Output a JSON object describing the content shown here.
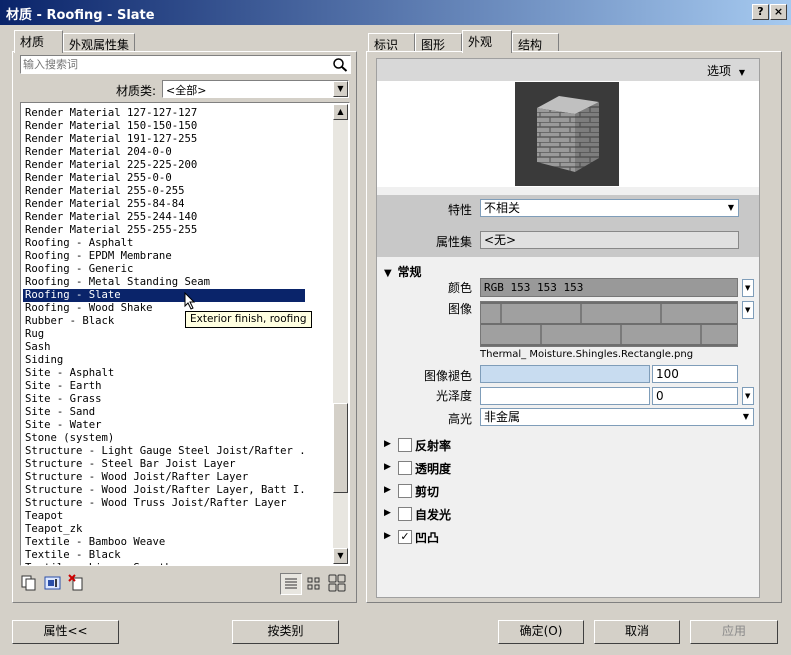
{
  "window": {
    "title": "材质 - Roofing - Slate",
    "help": "?",
    "close": "×"
  },
  "left": {
    "tabs": [
      "材质",
      "外观属性集"
    ],
    "search_placeholder": "输入搜索词",
    "category_label": "材质类:",
    "category_value": "<全部>",
    "materials": [
      "Render Material 127-127-127",
      "Render Material 150-150-150",
      "Render Material 191-127-255",
      "Render Material 204-0-0",
      "Render Material 225-225-200",
      "Render Material 255-0-0",
      "Render Material 255-0-255",
      "Render Material 255-84-84",
      "Render Material 255-244-140",
      "Render Material 255-255-255",
      "Roofing - Asphalt",
      "Roofing - EPDM Membrane",
      "Roofing - Generic",
      "Roofing - Metal Standing Seam",
      "Roofing - Slate",
      "Roofing - Wood Shake",
      "Rubber - Black",
      "Rug",
      "Sash",
      "Siding",
      "Site - Asphalt",
      "Site - Earth",
      "Site - Grass",
      "Site - Sand",
      "Site - Water",
      "Stone (system)",
      "Structure - Light Gauge Steel Joist/Rafter ...",
      "Structure - Steel Bar Joist Layer",
      "Structure - Wood Joist/Rafter Layer",
      "Structure - Wood Joist/Rafter Layer, Batt I...",
      "Structure - Wood Truss Joist/Rafter Layer",
      "Teapot",
      "Teapot_zk",
      "Textile - Bamboo Weave",
      "Textile - Black",
      "Textile - Linen, Smooth"
    ],
    "selected_index": 14,
    "tooltip": "Exterior finish, roofing"
  },
  "right": {
    "tabs": [
      "标识",
      "图形",
      "外观",
      "结构"
    ],
    "active_tab": 2,
    "options_label": "选项",
    "property_label": "特性",
    "property_value": "不相关",
    "propset_label": "属性集",
    "propset_value": "<无>",
    "general_section": "常规",
    "color_label": "颜色",
    "color_value": "RGB 153 153 153",
    "image_label": "图像",
    "image_filename": "Thermal_ Moisture.Shingles.Rectangle.png",
    "image_fade_label": "图像褪色",
    "image_fade_value": "100",
    "gloss_label": "光泽度",
    "gloss_value": "0",
    "highlight_label": "高光",
    "highlight_value": "非金属",
    "sections": [
      {
        "label": "反射率",
        "checked": false
      },
      {
        "label": "透明度",
        "checked": false
      },
      {
        "label": "剪切",
        "checked": false
      },
      {
        "label": "自发光",
        "checked": false
      },
      {
        "label": "凹凸",
        "checked": true
      }
    ],
    "colors": {
      "swatch": "#999999",
      "fade_fill": "#c8dcf0"
    }
  },
  "buttons": {
    "properties": "属性<<",
    "by_category": "按类别",
    "ok": "确定(O)",
    "cancel": "取消",
    "apply": "应用"
  }
}
